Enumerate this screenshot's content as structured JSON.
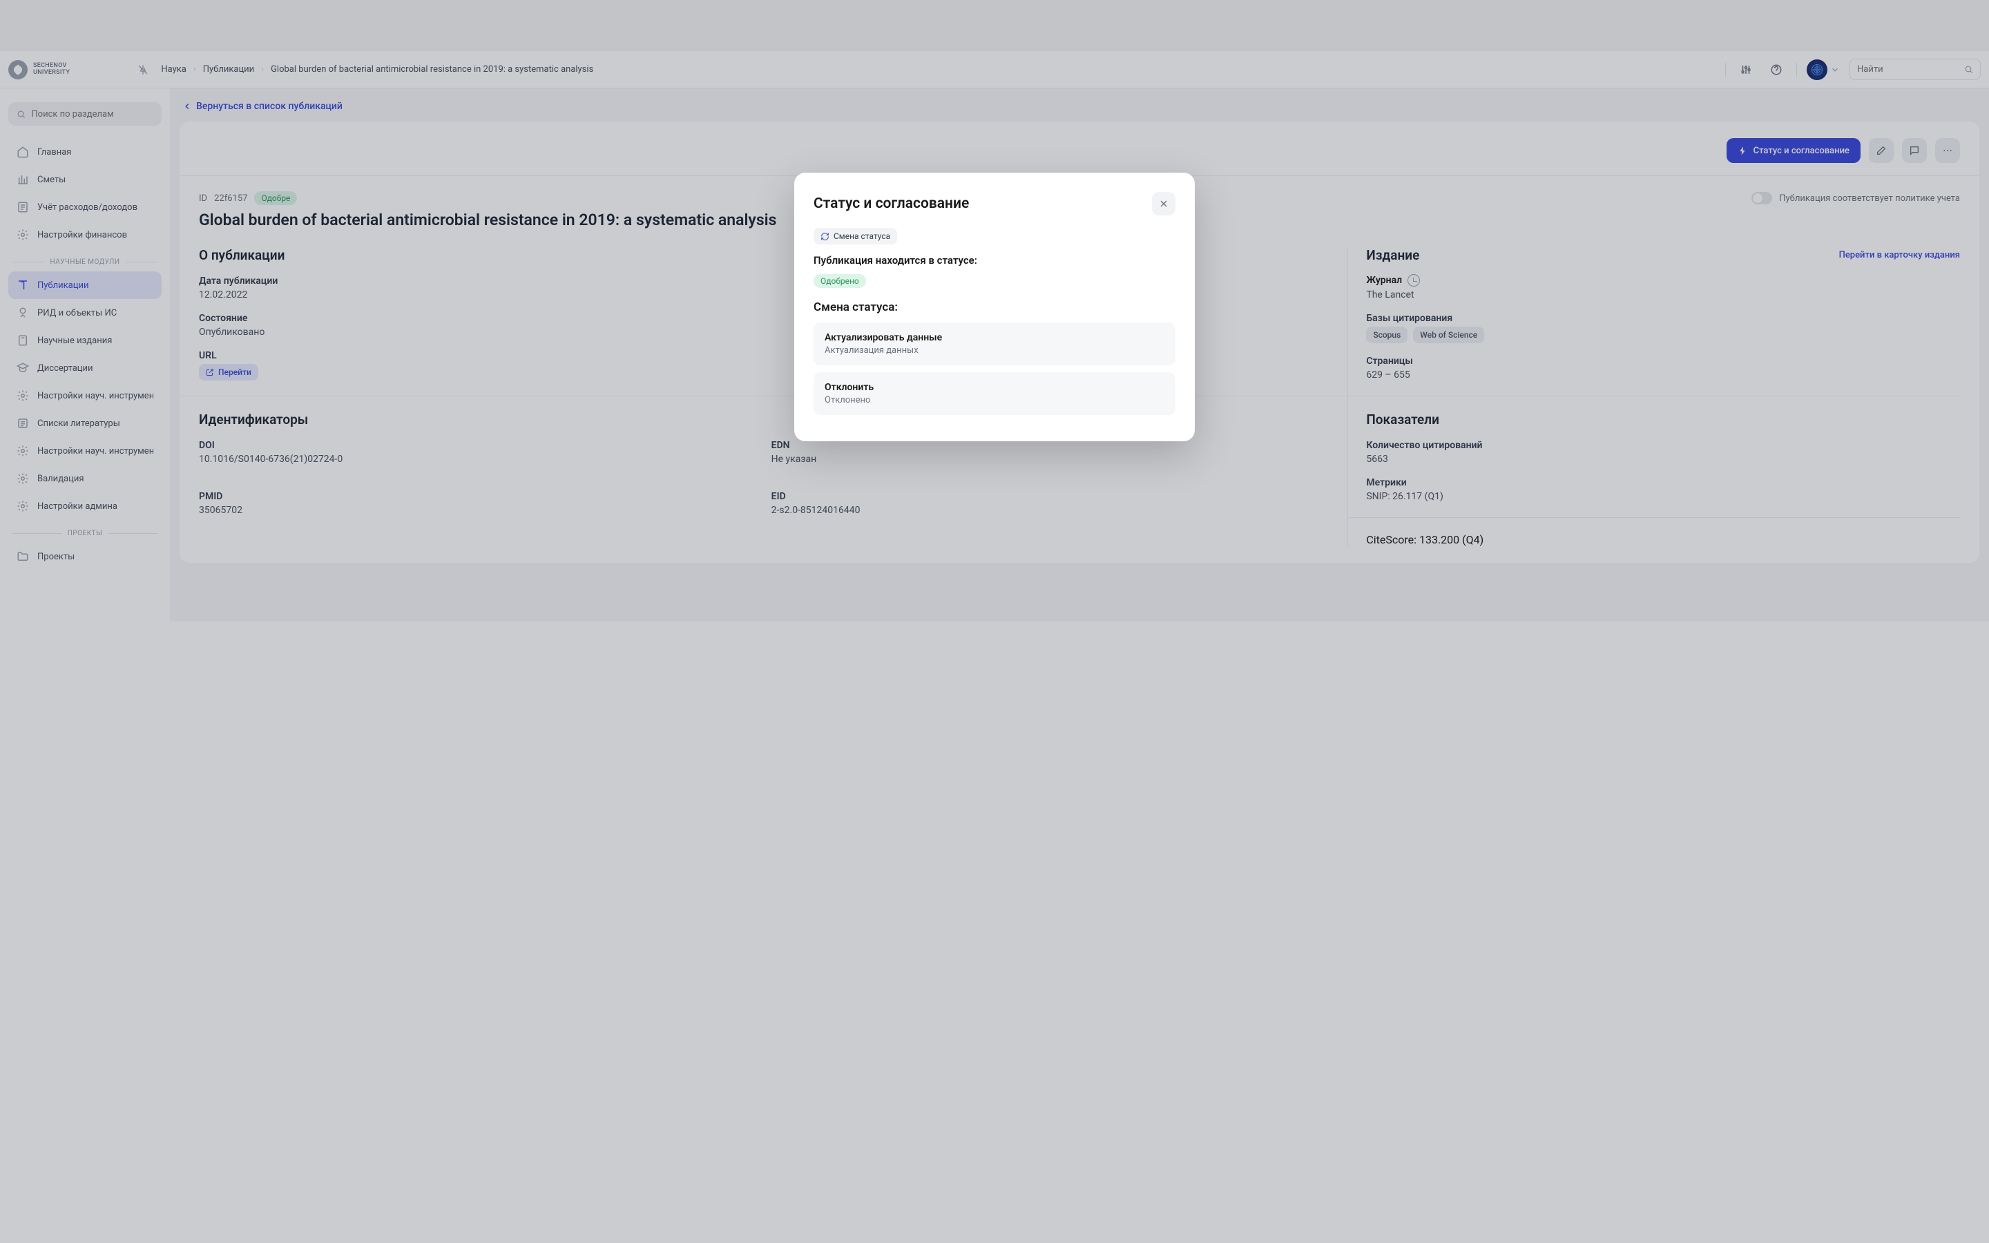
{
  "logo": {
    "line1": "SECHENOV",
    "line2": "UNIVERSITY"
  },
  "breadcrumb": {
    "items": [
      "Наука",
      "Публикации",
      "Global burden of bacterial antimicrobial resistance in 2019: a systematic analysis"
    ]
  },
  "topbar": {
    "search_placeholder": "Найти"
  },
  "sidebar": {
    "search_placeholder": "Поиск по разделам",
    "items": [
      {
        "icon": "home-icon",
        "label": "Главная"
      },
      {
        "icon": "columns-icon",
        "label": "Сметы"
      },
      {
        "icon": "ledger-icon",
        "label": "Учёт расходов/доходов"
      },
      {
        "icon": "gear-icon",
        "label": "Настройки финансов"
      }
    ],
    "section1": "НАУЧНЫЕ МОДУЛИ",
    "sci_items": [
      {
        "icon": "book-icon",
        "label": "Публикации",
        "active": true
      },
      {
        "icon": "ip-icon",
        "label": "РИД и объекты ИС"
      },
      {
        "icon": "journal-icon",
        "label": "Научные издания"
      },
      {
        "icon": "cap-icon",
        "label": "Диссертации"
      },
      {
        "icon": "gear-icon",
        "label": "Настройки науч. инструмент"
      },
      {
        "icon": "list-icon",
        "label": "Списки литературы"
      },
      {
        "icon": "gear-icon",
        "label": "Настройки науч. инструмент"
      },
      {
        "icon": "gear-icon",
        "label": "Валидация"
      },
      {
        "icon": "gear-icon",
        "label": "Настройки админа"
      }
    ],
    "section2": "ПРОЕКТЫ",
    "proj_items": [
      {
        "icon": "folder-icon",
        "label": "Проекты"
      }
    ]
  },
  "main": {
    "back": "Вернуться в список публикаций",
    "status_button": "Статус и согласование",
    "id_prefix": "ID",
    "id": "22f6157",
    "status_chip": "Одобре",
    "policy_toggle": "Публикация соответствует политике учета",
    "title": "Global burden of bacterial antimicrobial resistance in 2019: a systematic analysis",
    "about_h": "О публикации",
    "date_label": "Дата публикации",
    "date_value": "12.02.2022",
    "state_label": "Состояние",
    "state_value": "Опубликовано",
    "url_label": "URL",
    "url_chip": "Перейти",
    "ids_h": "Идентификаторы",
    "doi_label": "DOI",
    "doi_value": "10.1016/S0140-6736(21)02724-0",
    "pmid_label": "PMID",
    "pmid_value": "35065702",
    "edn_label": "EDN",
    "edn_value": "Не указан",
    "eid_label": "EID",
    "eid_value": "2-s2.0-85124016440"
  },
  "side": {
    "edition_h": "Издание",
    "edition_link": "Перейти в карточку издания",
    "journal_label": "Журнал",
    "journal_value": "The Lancet",
    "db_label": "Базы цитирования",
    "db_tags": [
      "Scopus",
      "Web of Science"
    ],
    "pages_label": "Страницы",
    "pages_value": "629 – 655",
    "metrics_h": "Показатели",
    "citations_label": "Количество цитирований",
    "citations_value": "5663",
    "metrics_label": "Метрики",
    "snip_value": "SNIP: 26.117 (Q1)",
    "citescore_value": "CiteScore: 133.200 (Q4)"
  },
  "modal": {
    "title": "Статус и согласование",
    "change_btn": "Смена статуса",
    "in_status_label": "Публикация находится в статусе:",
    "current_status": "Одобрено",
    "change_h": "Смена статуса:",
    "opt1_title": "Актуализировать данные",
    "opt1_sub": "Актуализация данных",
    "opt2_title": "Отклонить",
    "opt2_sub": "Отклонено"
  }
}
